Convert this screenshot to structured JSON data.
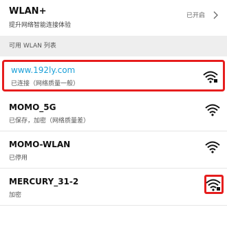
{
  "header": {
    "title": "WLAN+",
    "subtitle": "提升网络智能连接体验",
    "status": "已开启"
  },
  "section": {
    "label": "可用 WLAN 列表"
  },
  "networks": [
    {
      "name": "www.192ly.com",
      "status": "已连接（网络质量一般）",
      "icon": "wifi-signal-secure-icon"
    },
    {
      "name": "MOMO_5G",
      "status": "已保存，加密（网络质量差）",
      "icon": "wifi-signal-icon"
    },
    {
      "name": "MOMO-WLAN",
      "status": "已停用",
      "icon": "wifi-signal-icon"
    },
    {
      "name": "MERCURY_31-2",
      "status": "加密",
      "icon": "wifi-signal-secure-icon"
    }
  ],
  "colors": {
    "highlight": "#e61d1d",
    "connected": "#1aa0d8"
  }
}
